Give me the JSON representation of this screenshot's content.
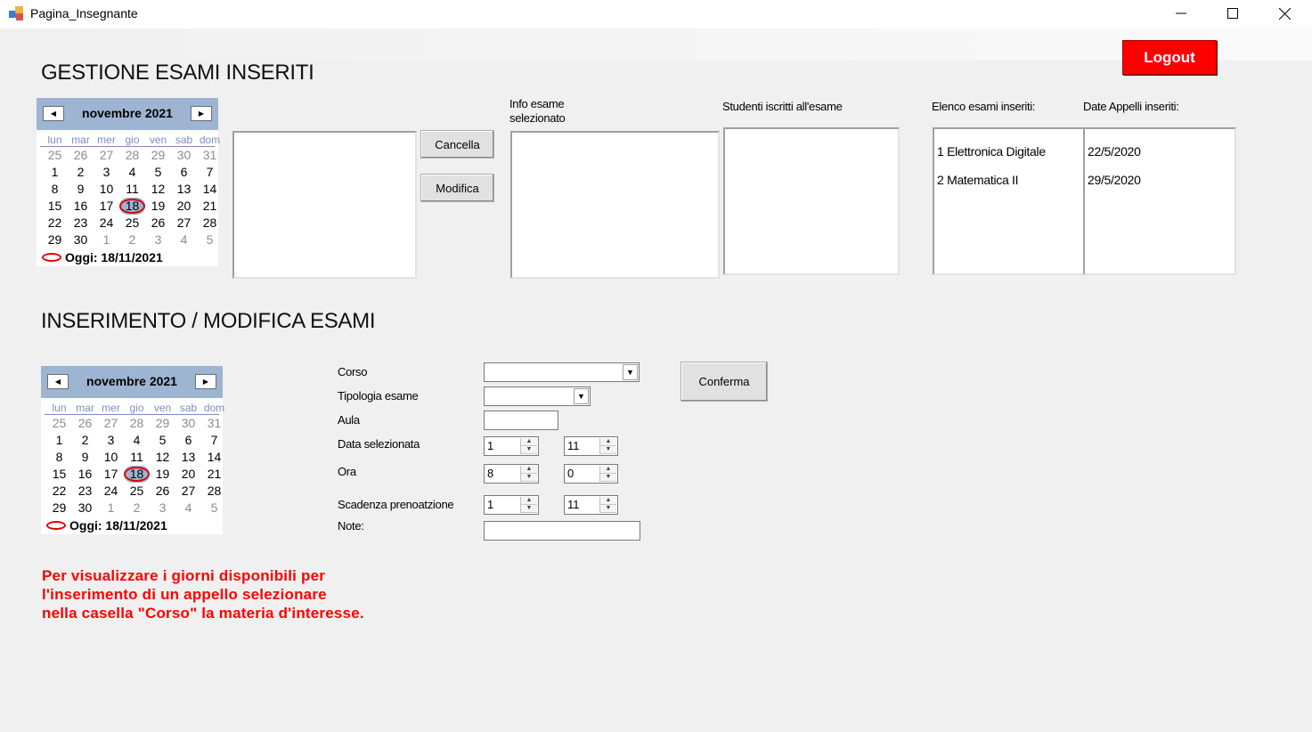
{
  "window": {
    "title": "Pagina_Insegnante"
  },
  "header": {
    "logout_label": "Logout"
  },
  "gestione": {
    "title": "GESTIONE ESAMI INSERITI",
    "cancella_label": "Cancella",
    "modifica_label": "Modifica",
    "info_label_1": "Info esame",
    "info_label_2": "selezionato",
    "studenti_label": "Studenti iscritti all'esame",
    "elenco_label": "Elenco esami inseriti:",
    "date_label": "Date Appelli inseriti:",
    "esami": [
      "1 Elettronica Digitale",
      "2 Matematica II"
    ],
    "date_appelli": [
      "22/5/2020",
      "29/5/2020"
    ]
  },
  "calendar": {
    "month_label": "novembre 2021",
    "weekdays": [
      "lun",
      "mar",
      "mer",
      "gio",
      "ven",
      "sab",
      "dom"
    ],
    "days": [
      "25",
      "26",
      "27",
      "28",
      "29",
      "30",
      "31",
      "1",
      "2",
      "3",
      "4",
      "5",
      "6",
      "7",
      "8",
      "9",
      "10",
      "11",
      "12",
      "13",
      "14",
      "15",
      "16",
      "17",
      "18",
      "19",
      "20",
      "21",
      "22",
      "23",
      "24",
      "25",
      "26",
      "27",
      "28",
      "29",
      "30",
      "1",
      "2",
      "3",
      "4",
      "5"
    ],
    "today_label": "Oggi: 18/11/2021"
  },
  "inserimento": {
    "title": "INSERIMENTO / MODIFICA ESAMI",
    "corso_label": "Corso",
    "tipologia_label": "Tipologia esame",
    "aula_label": "Aula",
    "data_label": "Data selezionata",
    "ora_label": "Ora",
    "scadenza_label": "Scadenza prenoatzione",
    "note_label": "Note:",
    "conferma_label": "Conferma",
    "data_day": "1",
    "data_month": "11",
    "ora_hour": "8",
    "ora_min": "0",
    "scadenza_day": "1",
    "scadenza_month": "11"
  },
  "info_note": {
    "line1": "Per visualizzare i giorni disponibili per",
    "line2": "l'inserimento di un appello selezionare",
    "line3": "nella casella \"Corso\" la materia d'interesse."
  },
  "colors": {
    "logout_bg": "#ff0000",
    "calendar_header": "#9db4d2",
    "note_text": "#ff0000",
    "today_ring": "#e00000"
  }
}
